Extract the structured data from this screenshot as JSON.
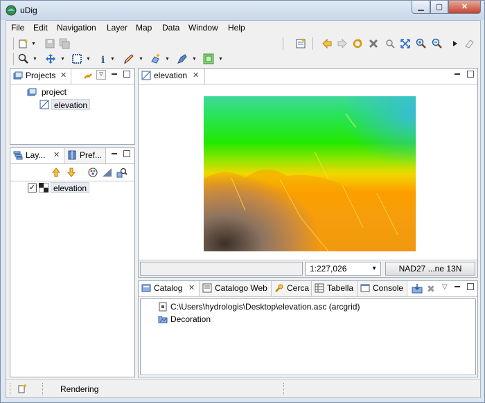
{
  "app": {
    "title": "uDig"
  },
  "window_buttons": {
    "minimize": "▁",
    "maximize": "▢",
    "close": "✕"
  },
  "menu": [
    "File",
    "Edit",
    "Navigation",
    "Layer",
    "Map",
    "Data",
    "Window",
    "Help"
  ],
  "projects_panel": {
    "tab_label": "Projects",
    "tree": [
      {
        "label": "project"
      },
      {
        "label": "elevation",
        "selected": true
      }
    ]
  },
  "layers_panel": {
    "tab_label": "Lay...",
    "tab2_label": "Pref...",
    "layers": [
      {
        "label": "elevation",
        "checked": true
      }
    ]
  },
  "editor": {
    "tab_label": "elevation",
    "scale": "1:227,026",
    "crs": "NAD27 ...ne 13N"
  },
  "bottom_panel": {
    "tabs": [
      "Catalog",
      "Catalogo Web",
      "Cerca",
      "Tabella",
      "Console"
    ],
    "items": [
      {
        "label": "C:\\Users\\hydrologis\\Desktop\\elevation.asc (arcgrid)",
        "icon": "file-icon"
      },
      {
        "label": "Decoration",
        "icon": "folder-icon"
      }
    ]
  },
  "status": {
    "text": "Rendering"
  },
  "colors": {
    "accent": "#3c78c0",
    "map_low": "#00c800",
    "map_high": "#ff8c00"
  }
}
